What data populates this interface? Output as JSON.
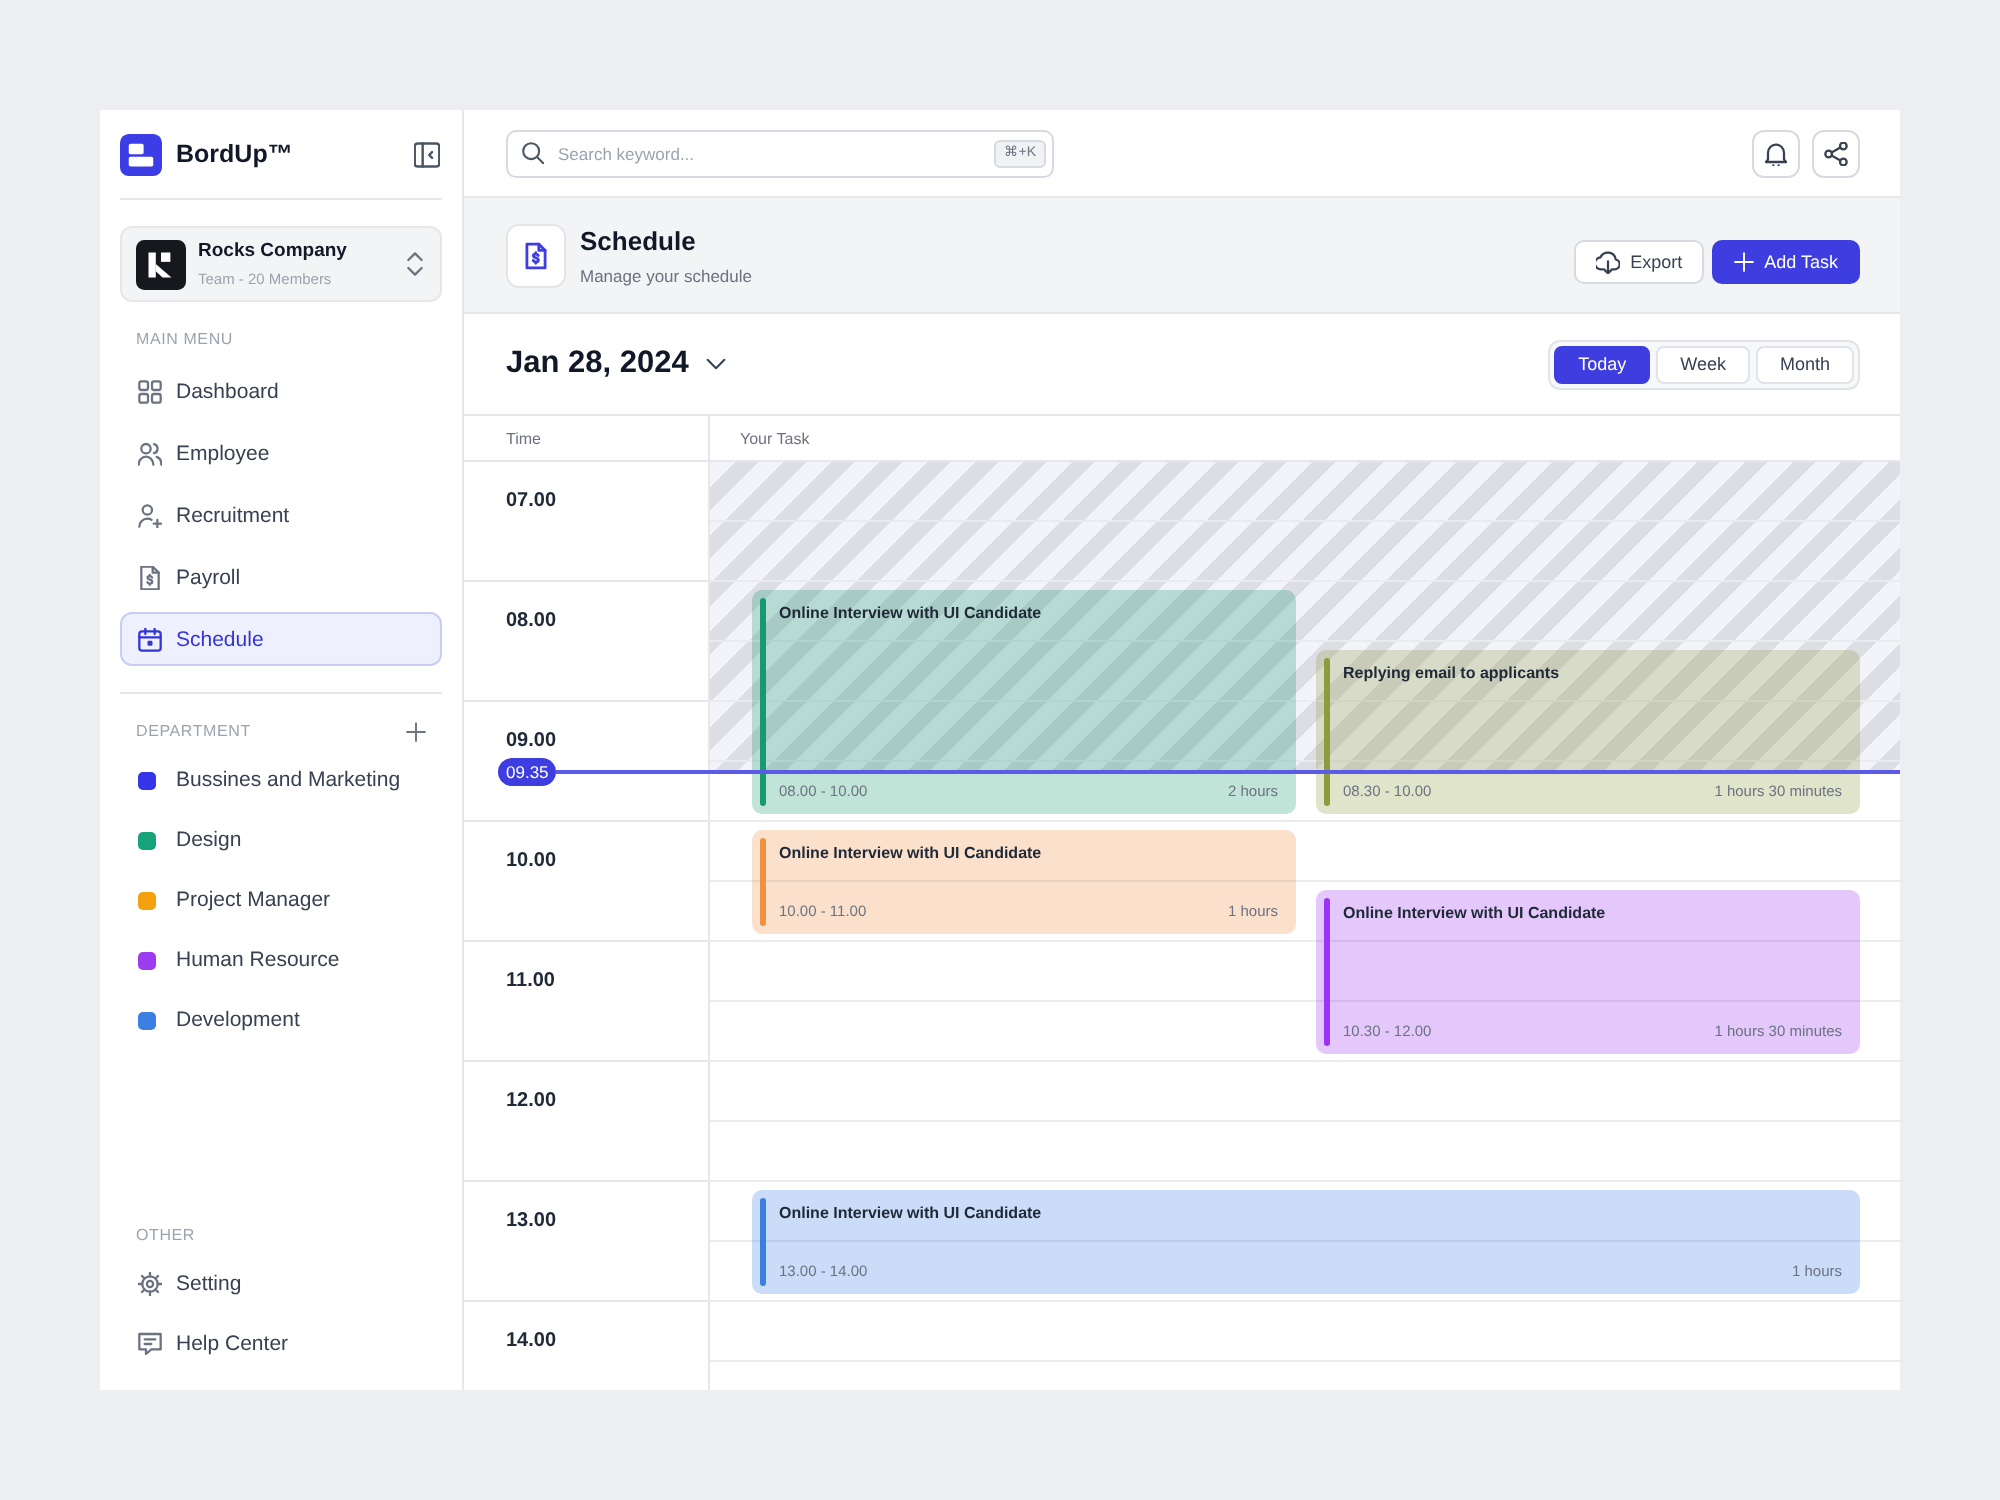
{
  "brand": {
    "name": "BordUp™"
  },
  "team": {
    "name": "Rocks Company",
    "subtitle": "Team - 20 Members"
  },
  "main_menu": {
    "heading": "MAIN MENU",
    "items": [
      {
        "label": "Dashboard",
        "selected": false
      },
      {
        "label": "Employee",
        "selected": false
      },
      {
        "label": "Recruitment",
        "selected": false
      },
      {
        "label": "Payroll",
        "selected": false
      },
      {
        "label": "Schedule",
        "selected": true
      }
    ]
  },
  "departments": {
    "heading": "DEPARTMENT",
    "items": [
      {
        "label": "Bussines and Marketing",
        "color": "#3535e8"
      },
      {
        "label": "Design",
        "color": "#16a37a"
      },
      {
        "label": "Project Manager",
        "color": "#f5a00f"
      },
      {
        "label": "Human Resource",
        "color": "#9b3cf0"
      },
      {
        "label": "Development",
        "color": "#3b7fe2"
      }
    ]
  },
  "other": {
    "heading": "OTHER",
    "items": [
      {
        "label": "Setting"
      },
      {
        "label": "Help Center"
      }
    ]
  },
  "search": {
    "placeholder": "Search keyword...",
    "shortcut": "⌘+K"
  },
  "page": {
    "title": "Schedule",
    "subtitle": "Manage your schedule",
    "buttons": [
      {
        "label": "Export",
        "kind": "secondary"
      },
      {
        "label": "Add Task",
        "kind": "primary"
      }
    ]
  },
  "date": {
    "label": "Jan 28, 2024"
  },
  "view_tabs": [
    {
      "label": "Today",
      "selected": true
    },
    {
      "label": "Week",
      "selected": false
    },
    {
      "label": "Month",
      "selected": false
    }
  ],
  "schedule": {
    "columns": [
      "Time",
      "Your Task"
    ],
    "hours": [
      "07.00",
      "08.00",
      "09.00",
      "10.00",
      "11.00",
      "12.00",
      "13.00",
      "14.00"
    ],
    "now": "09.35",
    "events": [
      {
        "title": "Online Interview with UI Candidate",
        "time": "08.00 - 10.00",
        "duration": "2 hours",
        "color": "#159b6e"
      },
      {
        "title": "Replying email to applicants",
        "time": "08.30 - 10.00",
        "duration": "1 hours 30 minutes",
        "color": "#8d9a3e"
      },
      {
        "title": "Online Interview with UI Candidate",
        "time": "10.00 - 11.00",
        "duration": "1 hours",
        "color": "#f0913f"
      },
      {
        "title": "Online Interview with UI Candidate",
        "time": "10.30 - 12.00",
        "duration": "1 hours 30 minutes",
        "color": "#9b34f5"
      },
      {
        "title": "Online Interview with UI Candidate",
        "time": "13.00 - 14.00",
        "duration": "1 hours",
        "color": "#3a7ee0"
      }
    ]
  }
}
